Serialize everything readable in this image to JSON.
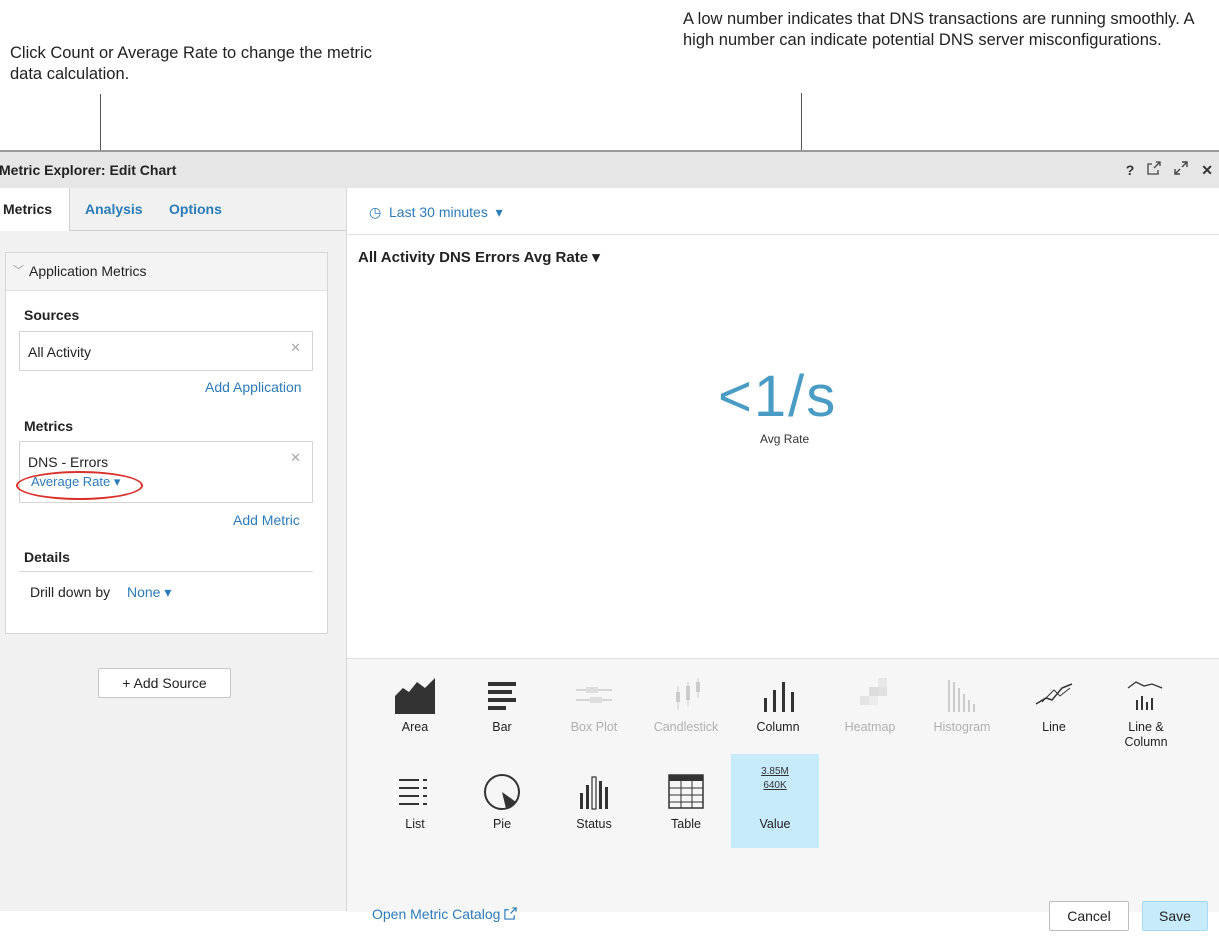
{
  "callouts": {
    "left": "Click Count or Average Rate to change the metric data calculation.",
    "right": "A low number indicates that DNS transactions are running smoothly. A high number can indicate potential DNS server misconfigurations."
  },
  "window": {
    "title": "Metric Explorer: Edit Chart",
    "controls": {
      "help": "?",
      "external": "external-link-icon",
      "expand": "expand-icon",
      "close": "✕"
    }
  },
  "tabs": [
    "Metrics",
    "Analysis",
    "Options"
  ],
  "left": {
    "section_title": "Application Metrics",
    "sources_label": "Sources",
    "source_value": "All Activity",
    "add_application": "Add Application",
    "metrics_label": "Metrics",
    "metric_value": "DNS - Errors",
    "metric_calc": "Average Rate ▾",
    "add_metric": "Add Metric",
    "details_label": "Details",
    "drill_label": "Drill down by",
    "drill_value": "None ▾",
    "add_source": "+ Add Source"
  },
  "right": {
    "time_range": "Last 30 minutes",
    "chart_title": "All Activity DNS Errors Avg Rate ▾",
    "big_value": "<1/s",
    "big_value_sub": "Avg Rate"
  },
  "chart_types": [
    {
      "name": "Area",
      "enabled": true,
      "selected": false
    },
    {
      "name": "Bar",
      "enabled": true,
      "selected": false
    },
    {
      "name": "Box Plot",
      "enabled": false,
      "selected": false
    },
    {
      "name": "Candlestick",
      "enabled": false,
      "selected": false
    },
    {
      "name": "Column",
      "enabled": true,
      "selected": false
    },
    {
      "name": "Heatmap",
      "enabled": false,
      "selected": false
    },
    {
      "name": "Histogram",
      "enabled": false,
      "selected": false
    },
    {
      "name": "Line",
      "enabled": true,
      "selected": false
    },
    {
      "name": "Line & Column",
      "enabled": true,
      "selected": false
    },
    {
      "name": "List",
      "enabled": true,
      "selected": false
    },
    {
      "name": "Pie",
      "enabled": true,
      "selected": false
    },
    {
      "name": "Status",
      "enabled": true,
      "selected": false
    },
    {
      "name": "Table",
      "enabled": true,
      "selected": false
    },
    {
      "name": "Value",
      "enabled": true,
      "selected": true
    }
  ],
  "value_icon_text": {
    "top": "3.85M",
    "bottom": "640K"
  },
  "footer": {
    "catalog_link": "Open Metric Catalog",
    "cancel": "Cancel",
    "save": "Save"
  },
  "colors": {
    "link": "#2b7bb9",
    "value": "#4a9cc4",
    "selected": "#c8ebfb",
    "highlight_oval": "#d9312b"
  }
}
